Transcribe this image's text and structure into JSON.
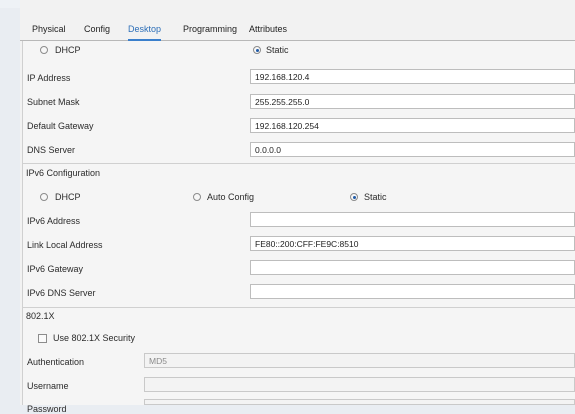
{
  "tabs": [
    "Physical",
    "Config",
    "Desktop",
    "Programming",
    "Attributes"
  ],
  "ipv4": {
    "dhcp_label": "DHCP",
    "static_label": "Static",
    "selected": "Static",
    "ip_label": "IP Address",
    "ip_value": "192.168.120.4",
    "mask_label": "Subnet Mask",
    "mask_value": "255.255.255.0",
    "gateway_label": "Default Gateway",
    "gateway_value": "192.168.120.254",
    "dns_label": "DNS Server",
    "dns_value": "0.0.0.0"
  },
  "ipv6": {
    "section_title": "IPv6 Configuration",
    "dhcp_label": "DHCP",
    "auto_label": "Auto Config",
    "static_label": "Static",
    "selected": "Static",
    "address_label": "IPv6 Address",
    "address_value": "",
    "link_local_label": "Link Local Address",
    "link_local_value": "FE80::200:CFF:FE9C:8510",
    "gateway_label": "IPv6 Gateway",
    "gateway_value": "",
    "dns_label": "IPv6 DNS Server",
    "dns_value": ""
  },
  "dot1x": {
    "section_title": "802.1X",
    "use_security_label": "Use 802.1X Security",
    "use_security_checked": false,
    "auth_label": "Authentication",
    "auth_value": "MD5",
    "username_label": "Username",
    "username_value": "",
    "password_label": "Password",
    "password_value": ""
  }
}
